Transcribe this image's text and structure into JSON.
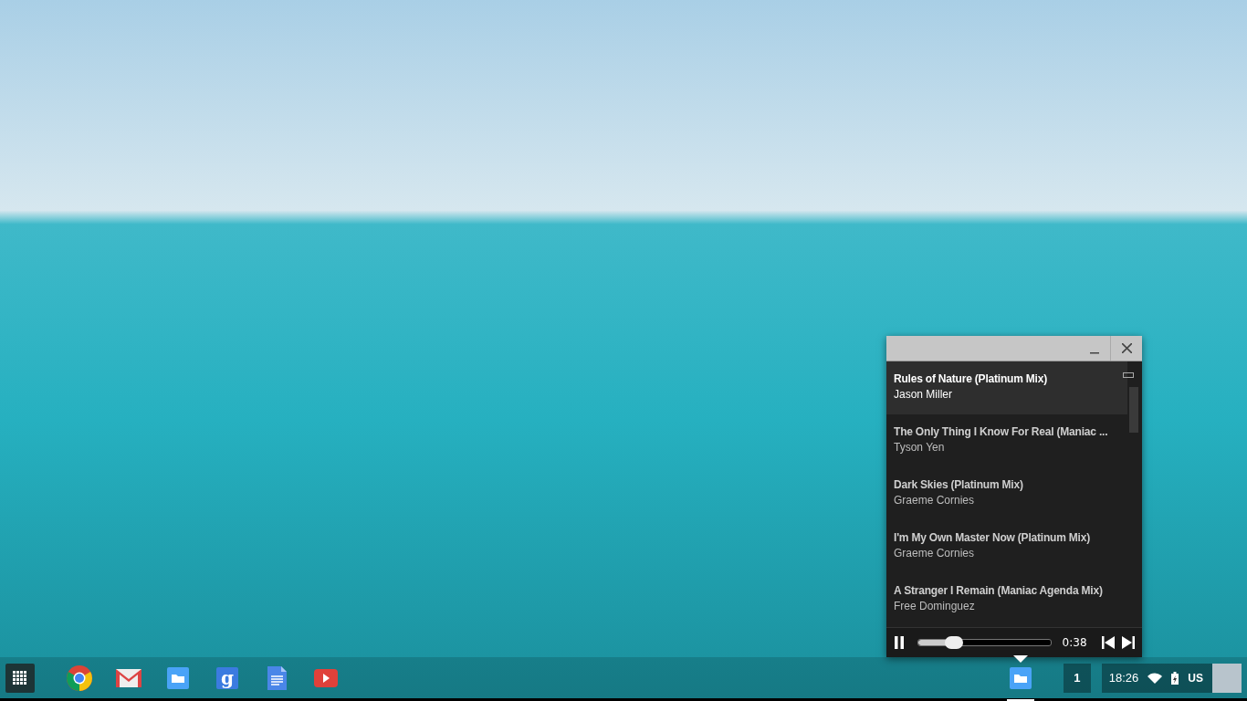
{
  "player": {
    "tracks": [
      {
        "title": "Rules of Nature (Platinum Mix)",
        "artist": "Jason Miller",
        "selected": true
      },
      {
        "title": "The Only Thing I Know For Real (Maniac ...",
        "artist": "Tyson Yen",
        "selected": false
      },
      {
        "title": "Dark Skies (Platinum Mix)",
        "artist": "Graeme Cornies",
        "selected": false
      },
      {
        "title": "I'm My Own Master Now (Platinum Mix)",
        "artist": "Graeme Cornies",
        "selected": false
      },
      {
        "title": "A Stranger I Remain (Maniac Agenda Mix)",
        "artist": "Free Dominguez",
        "selected": false
      }
    ],
    "playing": true,
    "progress": {
      "level": 0.27
    },
    "time": "0:38"
  },
  "shelf": {
    "launcher": [
      {
        "kind": "apps"
      },
      {
        "kind": "chrome"
      },
      {
        "kind": "mail"
      },
      {
        "kind": "files"
      },
      {
        "kind": "google",
        "glyph": "g"
      },
      {
        "kind": "docs"
      },
      {
        "kind": "video"
      }
    ],
    "running": [
      {
        "kind": "files",
        "active": true
      }
    ],
    "notifications": "1",
    "clock": "18:26",
    "ime": "US"
  }
}
